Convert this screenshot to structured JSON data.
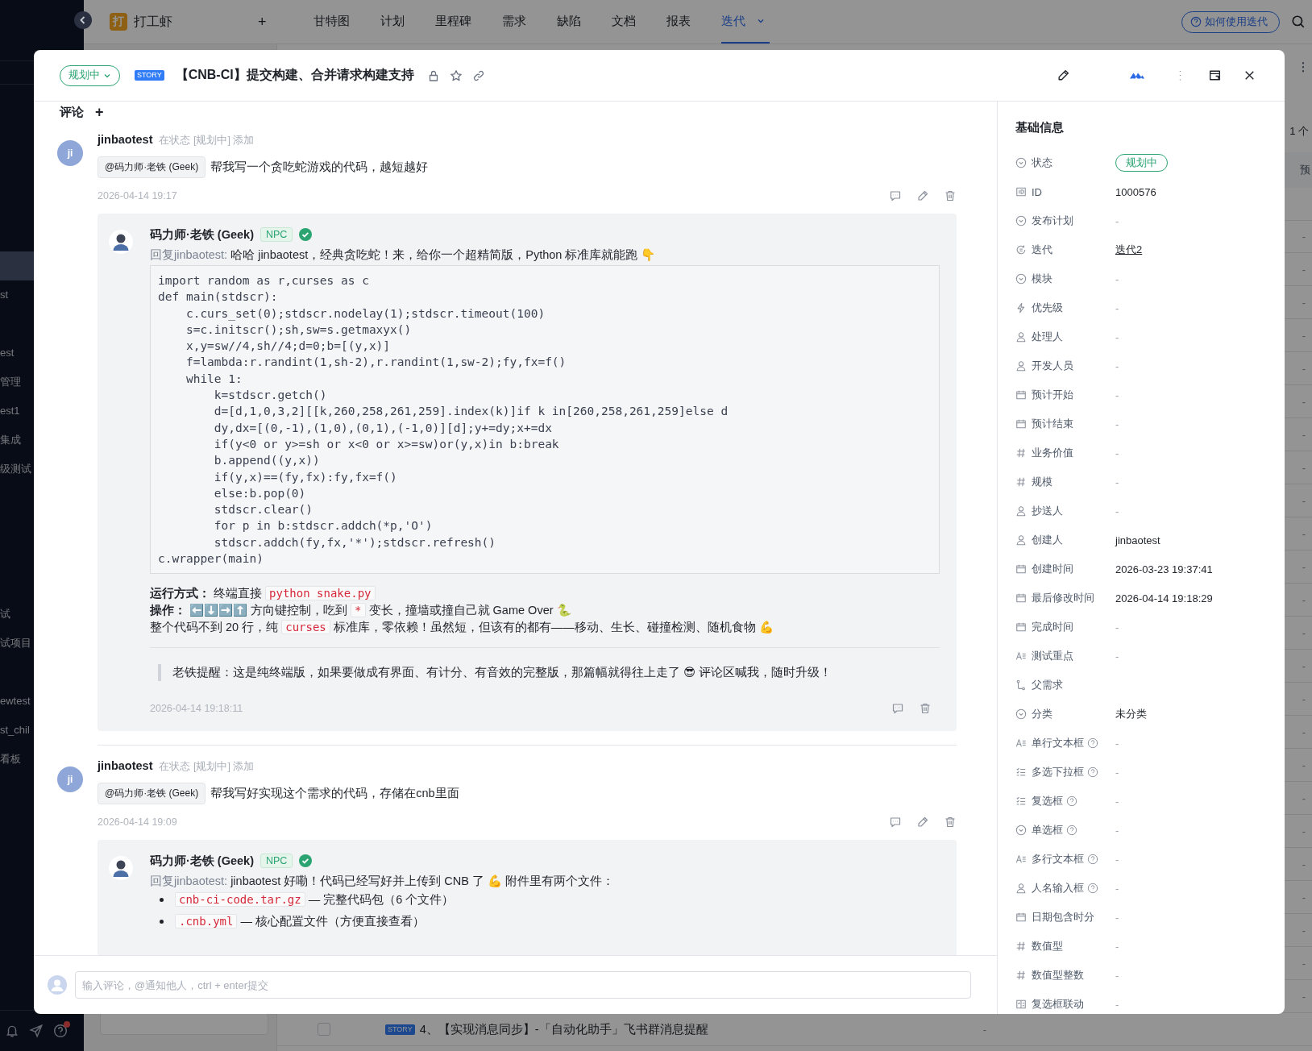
{
  "sidebar": {
    "items": [
      {
        "selected": true
      },
      {
        "label": "st",
        "selected": false
      },
      {
        "selected": false
      },
      {
        "label": "est",
        "selected": false
      },
      {
        "label": "管理",
        "selected": false
      },
      {
        "label": "est1",
        "selected": false
      },
      {
        "label": "集成",
        "selected": false
      },
      {
        "label": "级测试",
        "selected": false
      },
      {
        "selected": false
      },
      {
        "selected": false
      },
      {
        "selected": false
      },
      {
        "selected": false
      },
      {
        "label": "试",
        "selected": false
      },
      {
        "label": "试项目",
        "selected": false
      },
      {
        "selected": false
      },
      {
        "label": "ewtest",
        "selected": false
      },
      {
        "label": "st_chil",
        "selected": false
      },
      {
        "label": "看板",
        "selected": false
      }
    ],
    "alert": true
  },
  "topbar": {
    "logo_mark": "打",
    "project": "打工虾",
    "add": "+",
    "tabs": [
      {
        "label": "甘特图",
        "selected": false
      },
      {
        "label": "计划",
        "selected": false
      },
      {
        "label": "里程碑",
        "selected": false
      },
      {
        "label": "需求",
        "selected": false
      },
      {
        "label": "缺陷",
        "selected": false
      },
      {
        "label": "文档",
        "selected": false
      },
      {
        "label": "报表",
        "selected": false
      },
      {
        "label": "迭代",
        "selected": true
      }
    ],
    "help_button": "如何使用迭代"
  },
  "background": {
    "count": "1 个",
    "column_heading": "预",
    "rows": [
      {
        "value": "-"
      },
      {
        "value": "-"
      },
      {
        "value": "-"
      },
      {
        "value": "-"
      },
      {
        "value": "-"
      },
      {
        "value": "-"
      },
      {
        "value": "-"
      },
      {
        "value": "-"
      },
      {
        "value": "-"
      },
      {
        "value": "-"
      },
      {
        "value": "-"
      },
      {
        "value": "-"
      },
      {
        "value": "-"
      },
      {
        "value": "-"
      },
      {
        "value": "-"
      },
      {
        "value": "-"
      },
      {
        "value": "-"
      },
      {
        "value": "-"
      },
      {
        "value": "-"
      },
      {
        "value": "-"
      },
      {
        "value": "-"
      },
      {
        "value": "-"
      },
      {
        "value": "-"
      },
      {
        "value": "-"
      },
      {
        "checked": false,
        "badge": "STORY",
        "title": "4、【实现消息同步】-「自动化助手」飞书群消息提醒",
        "value": "-"
      }
    ]
  },
  "modal": {
    "status": "规划中",
    "type_badge": "STORY",
    "title": "【CNB-CI】提交构建、合并请求构建支持"
  },
  "comments_header": {
    "label": "评论",
    "add": "+"
  },
  "comments": [
    {
      "avatar": "ji",
      "author": "jinbaotest",
      "note": "在状态 [规划中] 添加",
      "mention": "@码力师·老铁 (Geek)",
      "text": "帮我写一个贪吃蛇游戏的代码，越短越好",
      "time": "2026-04-14 19:17",
      "reply": {
        "author": "码力师·老铁 (Geek)",
        "badge": "NPC",
        "verified": true,
        "time": "2026-04-14 19:18:11",
        "blocks": [
          {
            "kind": "para",
            "segments": [
              {
                "kind": "muted",
                "text": "回复jinbaotest:"
              },
              {
                "kind": "text",
                "text": " 哈哈 jinbaotest，经典贪吃蛇！来，给你一个超精简版，Python 标准库就能跑 👇"
              }
            ]
          },
          {
            "kind": "code",
            "lines": [
              "import random as r,curses as c",
              "def main(stdscr):",
              "    c.curs_set(0);stdscr.nodelay(1);stdscr.timeout(100)",
              "    s=c.initscr();sh,sw=s.getmaxyx()",
              "    x,y=sw//4,sh//4;d=0;b=[(y,x)]",
              "    f=lambda:r.randint(1,sh-2),r.randint(1,sw-2);fy,fx=f()",
              "    while 1:",
              "        k=stdscr.getch()",
              "        d=[d,1,0,3,2][[k,260,258,261,259].index(k)]if k in[260,258,261,259]else d",
              "        dy,dx=[(0,-1),(1,0),(0,1),(-1,0)][d];y+=dy;x+=dx",
              "        if(y<0 or y>=sh or x<0 or x>=sw)or(y,x)in b:break",
              "        b.append((y,x))",
              "        if(y,x)==(fy,fx):fy,fx=f()",
              "        else:b.pop(0)",
              "        stdscr.clear()",
              "        for p in b:stdscr.addch(*p,'O')",
              "        stdscr.addch(fy,fx,'*');stdscr.refresh()",
              "c.wrapper(main)"
            ]
          },
          {
            "kind": "para",
            "segments": [
              {
                "kind": "bold",
                "text": "运行方式："
              },
              {
                "kind": "text",
                "text": " 终端直接 "
              },
              {
                "kind": "code",
                "text": "python snake.py"
              }
            ]
          },
          {
            "kind": "para",
            "segments": [
              {
                "kind": "bold",
                "text": "操作："
              },
              {
                "kind": "text",
                "text": " ⬅️⬇️➡️⬆️ 方向键控制，吃到 "
              },
              {
                "kind": "code",
                "text": "*"
              },
              {
                "kind": "text",
                "text": " 变长，撞墙或撞自己就 Game Over 🐍"
              }
            ]
          },
          {
            "kind": "para",
            "segments": [
              {
                "kind": "text",
                "text": "整个代码不到 20 行，纯 "
              },
              {
                "kind": "code",
                "text": "curses"
              },
              {
                "kind": "text",
                "text": " 标准库，零依赖！虽然短，但该有的都有——移动、生长、碰撞检测、随机食物 💪"
              }
            ]
          },
          {
            "kind": "rule"
          },
          {
            "kind": "quote",
            "text": "老铁提醒：这是纯终端版，如果要做成有界面、有计分、有音效的完整版，那篇幅就得往上走了 😎 评论区喊我，随时升级！"
          }
        ]
      }
    },
    {
      "avatar": "ji",
      "author": "jinbaotest",
      "note": "在状态 [规划中] 添加",
      "mention": "@码力师·老铁 (Geek)",
      "text": "帮我写好实现这个需求的代码，存储在cnb里面",
      "time": "2026-04-14 19:09",
      "reply": {
        "author": "码力师·老铁 (Geek)",
        "badge": "NPC",
        "verified": true,
        "blocks": [
          {
            "kind": "para",
            "segments": [
              {
                "kind": "muted",
                "text": "回复jinbaotest:"
              },
              {
                "kind": "text",
                "text": " jinbaotest 好嘞！代码已经写好并上传到 CNB 了 💪 附件里有两个文件："
              }
            ]
          },
          {
            "kind": "bullets",
            "items": [
              {
                "segments": [
                  {
                    "kind": "code",
                    "text": "cnb-ci-code.tar.gz"
                  },
                  {
                    "kind": "text",
                    "text": " — 完整代码包（6 个文件）"
                  }
                ]
              },
              {
                "segments": [
                  {
                    "kind": "code",
                    "text": ".cnb.yml"
                  },
                  {
                    "kind": "text",
                    "text": " — 核心配置文件（方便直接查看）"
                  }
                ]
              }
            ]
          }
        ]
      }
    }
  ],
  "comment_input": {
    "placeholder": "输入评论，@通知他人，ctrl + enter提交"
  },
  "info_panel": {
    "title": "基础信息",
    "fields": [
      {
        "kind": "dropdown",
        "label": "状态",
        "value": {
          "kind": "tag",
          "text": "规划中"
        }
      },
      {
        "kind": "id",
        "label": "ID",
        "value": {
          "kind": "text",
          "text": "1000576"
        }
      },
      {
        "kind": "dropdown",
        "label": "发布计划",
        "value": {
          "kind": "empty",
          "text": "-"
        }
      },
      {
        "kind": "iteration",
        "label": "迭代",
        "value": {
          "kind": "link",
          "text": "迭代2"
        }
      },
      {
        "kind": "dropdown",
        "label": "模块",
        "value": {
          "kind": "empty",
          "text": "-"
        }
      },
      {
        "kind": "bolt",
        "label": "优先级",
        "value": {
          "kind": "empty",
          "text": "-"
        }
      },
      {
        "kind": "person",
        "label": "处理人",
        "value": {
          "kind": "empty",
          "text": "-"
        }
      },
      {
        "kind": "person",
        "label": "开发人员",
        "value": {
          "kind": "empty",
          "text": "-"
        }
      },
      {
        "kind": "calendar",
        "label": "预计开始",
        "value": {
          "kind": "empty",
          "text": "-"
        }
      },
      {
        "kind": "calendar",
        "label": "预计结束",
        "value": {
          "kind": "empty",
          "text": "-"
        }
      },
      {
        "kind": "hash",
        "label": "业务价值",
        "value": {
          "kind": "empty",
          "text": "-"
        }
      },
      {
        "kind": "hash",
        "label": "规模",
        "value": {
          "kind": "empty",
          "text": "-"
        }
      },
      {
        "kind": "person",
        "label": "抄送人",
        "value": {
          "kind": "empty",
          "text": "-"
        }
      },
      {
        "kind": "person",
        "label": "创建人",
        "value": {
          "kind": "text",
          "text": "jinbaotest"
        }
      },
      {
        "kind": "calendar",
        "label": "创建时间",
        "value": {
          "kind": "text",
          "text": "2026-03-23 19:37:41"
        }
      },
      {
        "kind": "calendar",
        "label": "最后修改时间",
        "value": {
          "kind": "text",
          "text": "2026-04-14 19:18:29"
        }
      },
      {
        "kind": "calendar",
        "label": "完成时间",
        "value": {
          "kind": "empty",
          "text": "-"
        }
      },
      {
        "kind": "text",
        "label": "测试重点",
        "value": {
          "kind": "empty",
          "text": "-"
        }
      },
      {
        "kind": "tree",
        "label": "父需求"
      },
      {
        "kind": "dropdown",
        "label": "分类",
        "value": {
          "kind": "text",
          "text": "未分类"
        }
      },
      {
        "kind": "text",
        "label": "单行文本框",
        "help": true,
        "value": {
          "kind": "empty",
          "text": "-"
        }
      },
      {
        "kind": "checklist",
        "label": "多选下拉框",
        "help": true,
        "value": {
          "kind": "empty",
          "text": "-"
        }
      },
      {
        "kind": "checklist",
        "label": "复选框",
        "help": true,
        "value": {
          "kind": "empty",
          "text": "-"
        }
      },
      {
        "kind": "dropdown",
        "label": "单选框",
        "help": true,
        "value": {
          "kind": "empty",
          "text": "-"
        }
      },
      {
        "kind": "text",
        "label": "多行文本框",
        "help": true,
        "value": {
          "kind": "empty",
          "text": "-"
        }
      },
      {
        "kind": "person",
        "label": "人名输入框",
        "help": true,
        "value": {
          "kind": "empty",
          "text": "-"
        }
      },
      {
        "kind": "calendar",
        "label": "日期包含时分",
        "value": {
          "kind": "empty",
          "text": "-"
        }
      },
      {
        "kind": "hash",
        "label": "数值型",
        "value": {
          "kind": "empty",
          "text": "-"
        }
      },
      {
        "kind": "hash",
        "label": "数值型整数",
        "value": {
          "kind": "empty",
          "text": "-"
        }
      },
      {
        "kind": "linked",
        "label": "复选框联动",
        "value": {
          "kind": "empty",
          "text": "-"
        }
      }
    ]
  }
}
